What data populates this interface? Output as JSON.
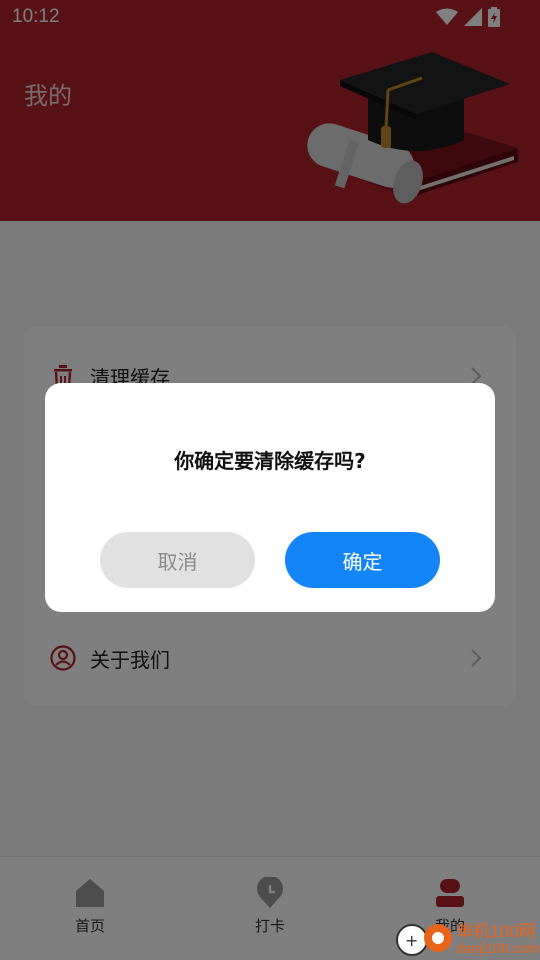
{
  "status_bar": {
    "time": "10:12"
  },
  "header": {
    "title": "我的"
  },
  "menu": {
    "items": [
      {
        "label": "清理缓存",
        "icon": "trash-icon"
      },
      {
        "label": "关于我们",
        "icon": "user-circle-icon"
      }
    ]
  },
  "dialog": {
    "message": "你确定要清除缓存吗?",
    "cancel_label": "取消",
    "confirm_label": "确定"
  },
  "tabbar": {
    "tabs": [
      {
        "label": "首页",
        "icon": "home-icon",
        "active": false
      },
      {
        "label": "打卡",
        "icon": "clock-pin-icon",
        "active": false
      },
      {
        "label": "我的",
        "icon": "profile-icon",
        "active": true
      }
    ]
  },
  "colors": {
    "header_bg": "#b1252a",
    "primary_button": "#1485f7",
    "secondary_button": "#e1e1e1",
    "icon_accent": "#b1252a"
  },
  "watermark": {
    "brand": "单机100网",
    "domain": "danji100.com"
  }
}
